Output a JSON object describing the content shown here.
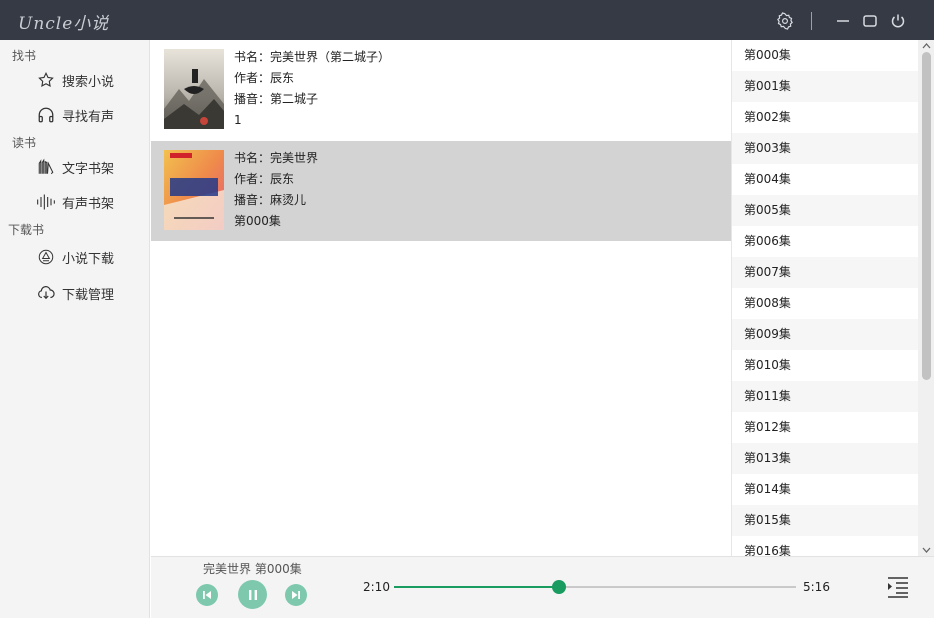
{
  "app": {
    "title": "Uncle小说"
  },
  "window_controls": {
    "settings_icon": "gear-icon",
    "minimize_icon": "minimize-icon",
    "maximize_icon": "maximize-icon",
    "power_icon": "power-icon"
  },
  "sidebar": {
    "sections": [
      {
        "label": "找书",
        "items": [
          {
            "label": "搜索小说",
            "icon": "star-icon"
          },
          {
            "label": "寻找有声",
            "icon": "headphones-icon"
          }
        ]
      },
      {
        "label": "读书",
        "items": [
          {
            "label": "文字书架",
            "icon": "books-icon"
          },
          {
            "label": "有声书架",
            "icon": "soundwave-icon"
          }
        ]
      },
      {
        "label": "下载书",
        "items": [
          {
            "label": "小说下载",
            "icon": "download-circle-icon"
          },
          {
            "label": "下载管理",
            "icon": "cloud-download-icon"
          }
        ]
      }
    ]
  },
  "books": [
    {
      "name": "书名：完美世界（第二城子）",
      "author": "作者：辰东",
      "narrator": "播音：第二城子",
      "progress": "1",
      "selected": false
    },
    {
      "name": "书名：完美世界",
      "author": "作者：辰东",
      "narrator": "播音：麻烫儿",
      "progress": "第000集",
      "selected": true
    }
  ],
  "episodes": [
    "第000集",
    "第001集",
    "第002集",
    "第003集",
    "第004集",
    "第005集",
    "第006集",
    "第007集",
    "第008集",
    "第009集",
    "第010集",
    "第011集",
    "第012集",
    "第013集",
    "第014集",
    "第015集",
    "第016集"
  ],
  "player": {
    "now_playing": "完美世界 第000集",
    "current_time": "2:10",
    "total_time": "5:16",
    "progress_fraction": 0.41,
    "accent_color": "#1a9b60",
    "button_color": "#7ec8ae",
    "prev_icon": "skip-previous-icon",
    "pause_icon": "pause-icon",
    "next_icon": "skip-next-icon",
    "playlist_icon": "playlist-icon"
  }
}
